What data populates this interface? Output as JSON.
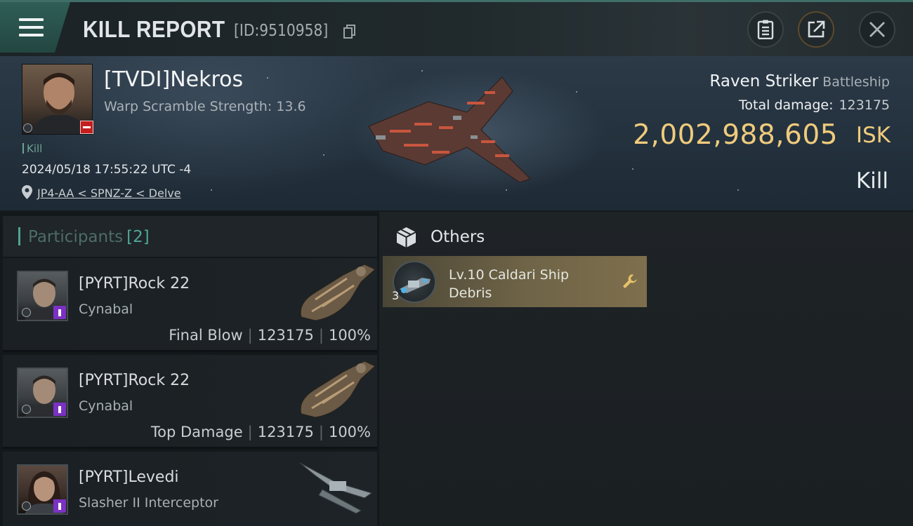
{
  "topbar": {
    "title": "KILL REPORT",
    "report_id": "[ID:9510958]",
    "icons": [
      "menu-icon",
      "copy-icon",
      "report-icon",
      "share-icon",
      "close-icon"
    ]
  },
  "victim": {
    "name": "[TVDI]Nekros",
    "warp_scramble": "Warp Scramble Strength: 13.6",
    "kill_tag": "Kill",
    "datetime": "2024/05/18 17:55:22 UTC -4",
    "location": "JP4-AA < SPNZ-Z < Delve",
    "ship_name": "Raven Striker",
    "ship_class": "Battleship",
    "total_damage_label": "Total damage:",
    "total_damage_value": "123175",
    "isk_value": "2,002,988,605",
    "isk_unit": "ISK",
    "result_label": "Kill"
  },
  "participants": {
    "label": "Participants",
    "count": "[2]",
    "rows": [
      {
        "name": "[PYRT]Rock 22",
        "ship": "Cynabal",
        "role": "Final Blow",
        "damage": "123175",
        "percent": "100%"
      },
      {
        "name": "[PYRT]Rock 22",
        "ship": "Cynabal",
        "role": "Top Damage",
        "damage": "123175",
        "percent": "100%"
      },
      {
        "name": "[PYRT]Levedi",
        "ship": "Slasher II Interceptor"
      }
    ]
  },
  "others": {
    "label": "Others",
    "items": [
      {
        "name": "Lv.10 Caldari Ship Debris",
        "quantity": "3"
      }
    ]
  },
  "colors": {
    "accent_teal": "#52a394",
    "isk_gold": "#f0cb7c",
    "loss_red": "#c41e1e",
    "badge_purple": "#7b31c4",
    "item_card_gold": "#6f6447"
  }
}
